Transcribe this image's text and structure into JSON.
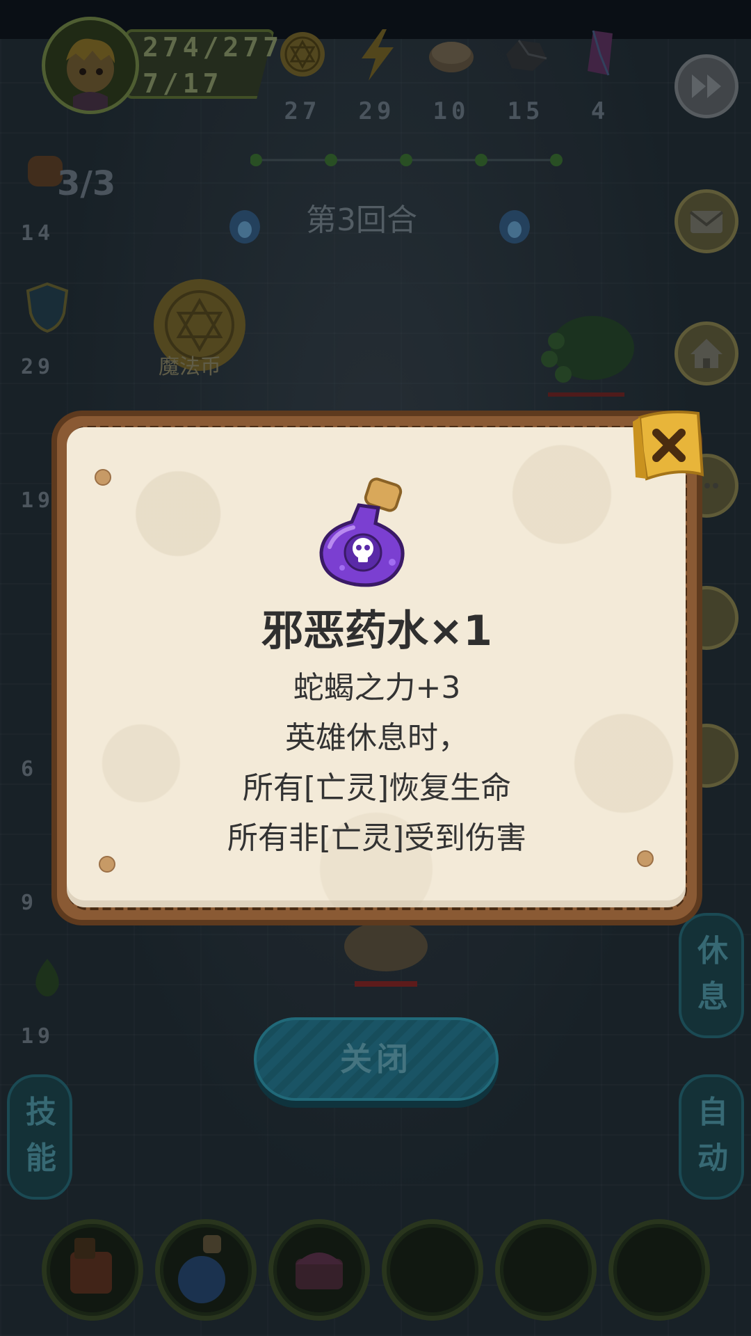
{
  "hud": {
    "hp": "274/277",
    "sub": "7/17"
  },
  "resources": [
    {
      "icon": "gold-coin-icon",
      "value": "27"
    },
    {
      "icon": "lightning-icon",
      "value": "29"
    },
    {
      "icon": "bread-icon",
      "value": "10"
    },
    {
      "icon": "ore-icon",
      "value": "15"
    },
    {
      "icon": "crystal-icon",
      "value": "4"
    }
  ],
  "left_stats": {
    "fist_count": "3/3",
    "attack": "14",
    "defense": "29",
    "stat3": "19",
    "stat4": "6",
    "stat5": "9",
    "stat6": "19"
  },
  "round_label": "第3回合",
  "coin_label": "魔法币",
  "modal": {
    "title": "邪恶药水×1",
    "line1": "蛇蝎之力+3",
    "line2": "英雄休息时，",
    "line3": "所有[亡灵]恢复生命",
    "line4": "所有非[亡灵]受到伤害"
  },
  "buttons": {
    "close": "关闭",
    "rest": "休息",
    "auto": "自动",
    "skill": "技能"
  },
  "colors": {
    "paper": "#f3ead8",
    "frame": "#8a5a34",
    "potion": "#7b3fd1",
    "close_x_bg": "#e8b53a",
    "teal_button": "#1e6073"
  }
}
